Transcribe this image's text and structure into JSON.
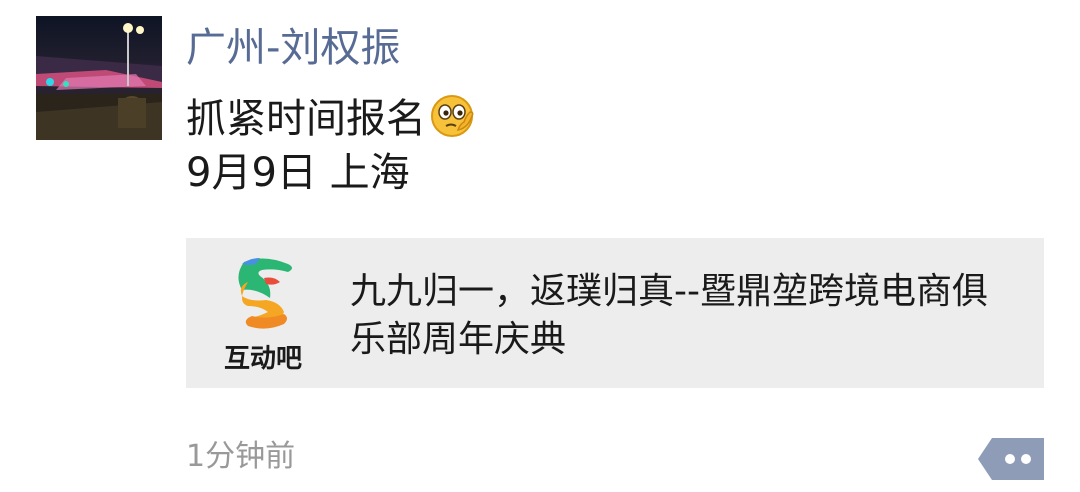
{
  "post": {
    "nickname": "广州-刘权振",
    "text_line1": "抓紧时间报名",
    "text_line2": "9月9日 上海",
    "emoji": "thinking-face-emoji"
  },
  "link_card": {
    "icon": "hands-logo-icon",
    "icon_caption": "互动吧",
    "title": "九九归一，返璞归真--暨鼎堃跨境电商俱乐部周年庆典"
  },
  "footer": {
    "timestamp": "1分钟前",
    "more_icon": "more-dots-icon"
  },
  "colors": {
    "nickname": "#576b95",
    "card_background": "#ededed",
    "timestamp": "#999999",
    "more_button": "#8f9cb7"
  }
}
